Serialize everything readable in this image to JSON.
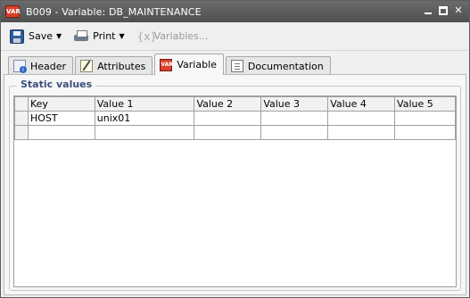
{
  "window": {
    "title": "B009 - Variable: DB_MAINTENANCE",
    "icon": "variable-icon",
    "controls": [
      "minimize",
      "maximize",
      "close"
    ]
  },
  "toolbar": {
    "save_label": "Save",
    "print_label": "Print",
    "variables_label": "Variables..."
  },
  "tabs": [
    {
      "label": "Header",
      "icon": "header-icon",
      "active": false
    },
    {
      "label": "Attributes",
      "icon": "attributes-icon",
      "active": false
    },
    {
      "label": "Variable",
      "icon": "variable-icon",
      "active": true
    },
    {
      "label": "Documentation",
      "icon": "documentation-icon",
      "active": false
    }
  ],
  "static_values": {
    "title": "Static values",
    "columns": [
      "Key",
      "Value 1",
      "Value 2",
      "Value 3",
      "Value 4",
      "Value 5"
    ],
    "rows": [
      [
        "HOST",
        "unix01",
        "",
        "",
        "",
        ""
      ],
      [
        "",
        "",
        "",
        "",
        "",
        ""
      ]
    ]
  }
}
